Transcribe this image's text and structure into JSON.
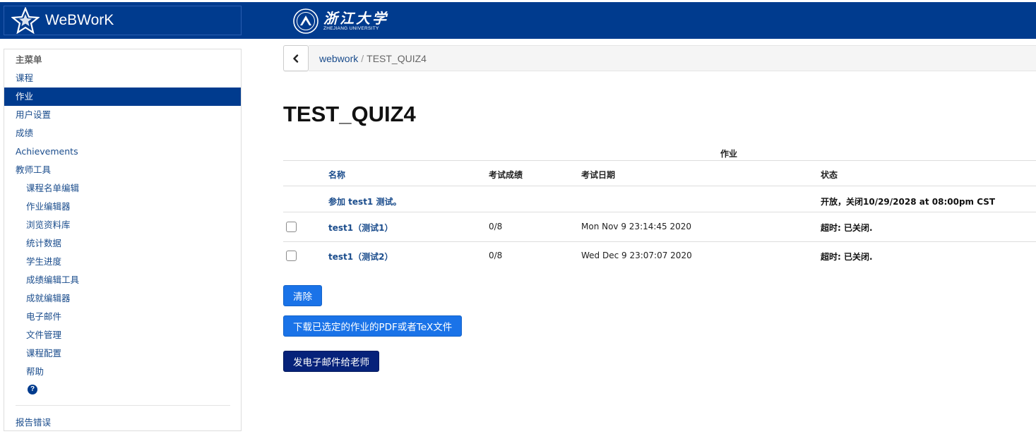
{
  "header": {
    "brand": "WeBWorK",
    "university_cn": "浙江大学",
    "university_en": "ZHEJIANG UNIVERSITY",
    "bar_color": "#003b8e"
  },
  "sidebar": {
    "main_menu": "主菜单",
    "items": [
      {
        "label": "课程"
      },
      {
        "label": "作业"
      },
      {
        "label": "用户设置"
      },
      {
        "label": "成绩"
      },
      {
        "label": "Achievements"
      },
      {
        "label": "教师工具"
      }
    ],
    "instructor_tools": [
      {
        "label": "课程名单编辑"
      },
      {
        "label": "作业编辑器"
      },
      {
        "label": "浏览资料库"
      },
      {
        "label": "统计数据"
      },
      {
        "label": "学生进度"
      },
      {
        "label": "成绩编辑工具"
      },
      {
        "label": "成就编辑器"
      },
      {
        "label": "电子邮件"
      },
      {
        "label": "文件管理"
      },
      {
        "label": "课程配置"
      },
      {
        "label": "帮助"
      }
    ],
    "help_icon": "?",
    "report_bugs": "报告错误"
  },
  "breadcrumb": {
    "link": "webwork",
    "separator": "/",
    "current": "TEST_QUIZ4"
  },
  "page_title": "TEST_QUIZ4",
  "table": {
    "caption": "作业",
    "columns": [
      "名称",
      "考试成绩",
      "考试日期",
      "状态"
    ],
    "take_row": {
      "name": "参加 test1 测试。",
      "status": "开放，关闭10/29/2028 at 08:00pm CST"
    },
    "rows": [
      {
        "name": "test1（测试1）",
        "score": "0/8",
        "date": "Mon Nov 9 23:14:45 2020",
        "status": "超时: 已关闭."
      },
      {
        "name": "test1（测试2）",
        "score": "0/8",
        "date": "Wed Dec 9 23:07:07 2020",
        "status": "超时: 已关闭."
      }
    ]
  },
  "buttons": {
    "clear": "清除",
    "download": "下载已选定的作业的PDF或者TeX文件",
    "email": "发电子邮件给老师"
  }
}
